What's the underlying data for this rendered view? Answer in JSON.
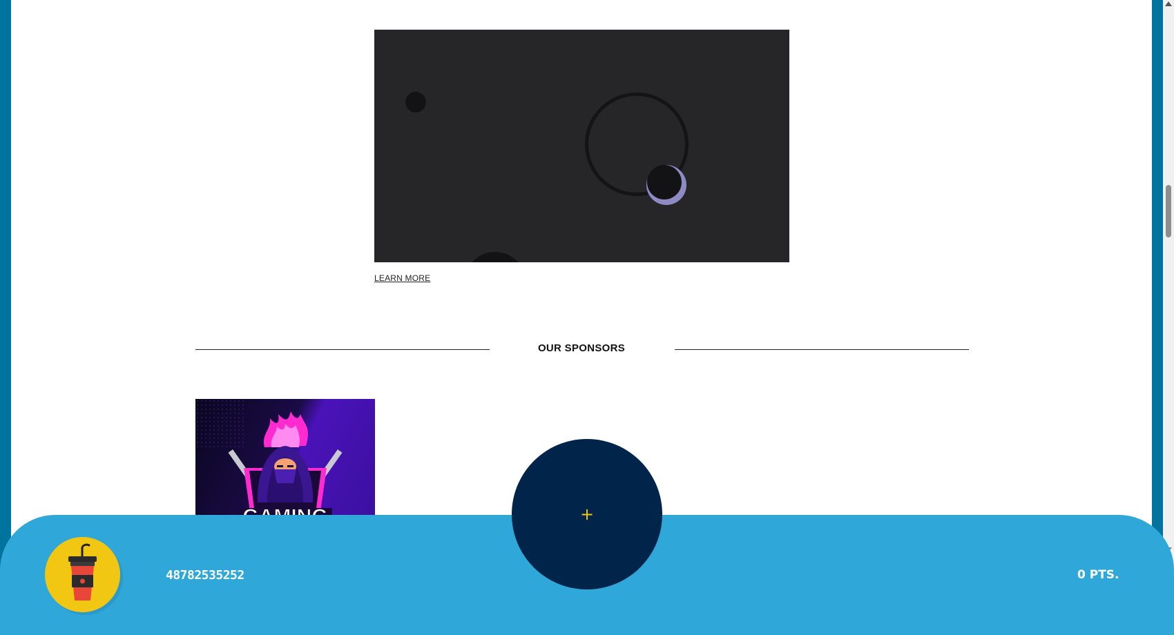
{
  "content": {
    "learn_more_label": "LEARN MORE",
    "sponsors_heading": "OUR SPONSORS",
    "sponsor_logo_text": "GAMING"
  },
  "bottom_bar": {
    "user_id": "48782535252",
    "points_label": "0 PTS.",
    "fab_symbol": "+",
    "avatar_icon": "drink-cup-icon"
  },
  "colors": {
    "frame": "#00739f",
    "bottom_bar": "#2fa8d9",
    "fab": "#00244a",
    "accent": "#f2c713",
    "video_bg": "#262629"
  }
}
